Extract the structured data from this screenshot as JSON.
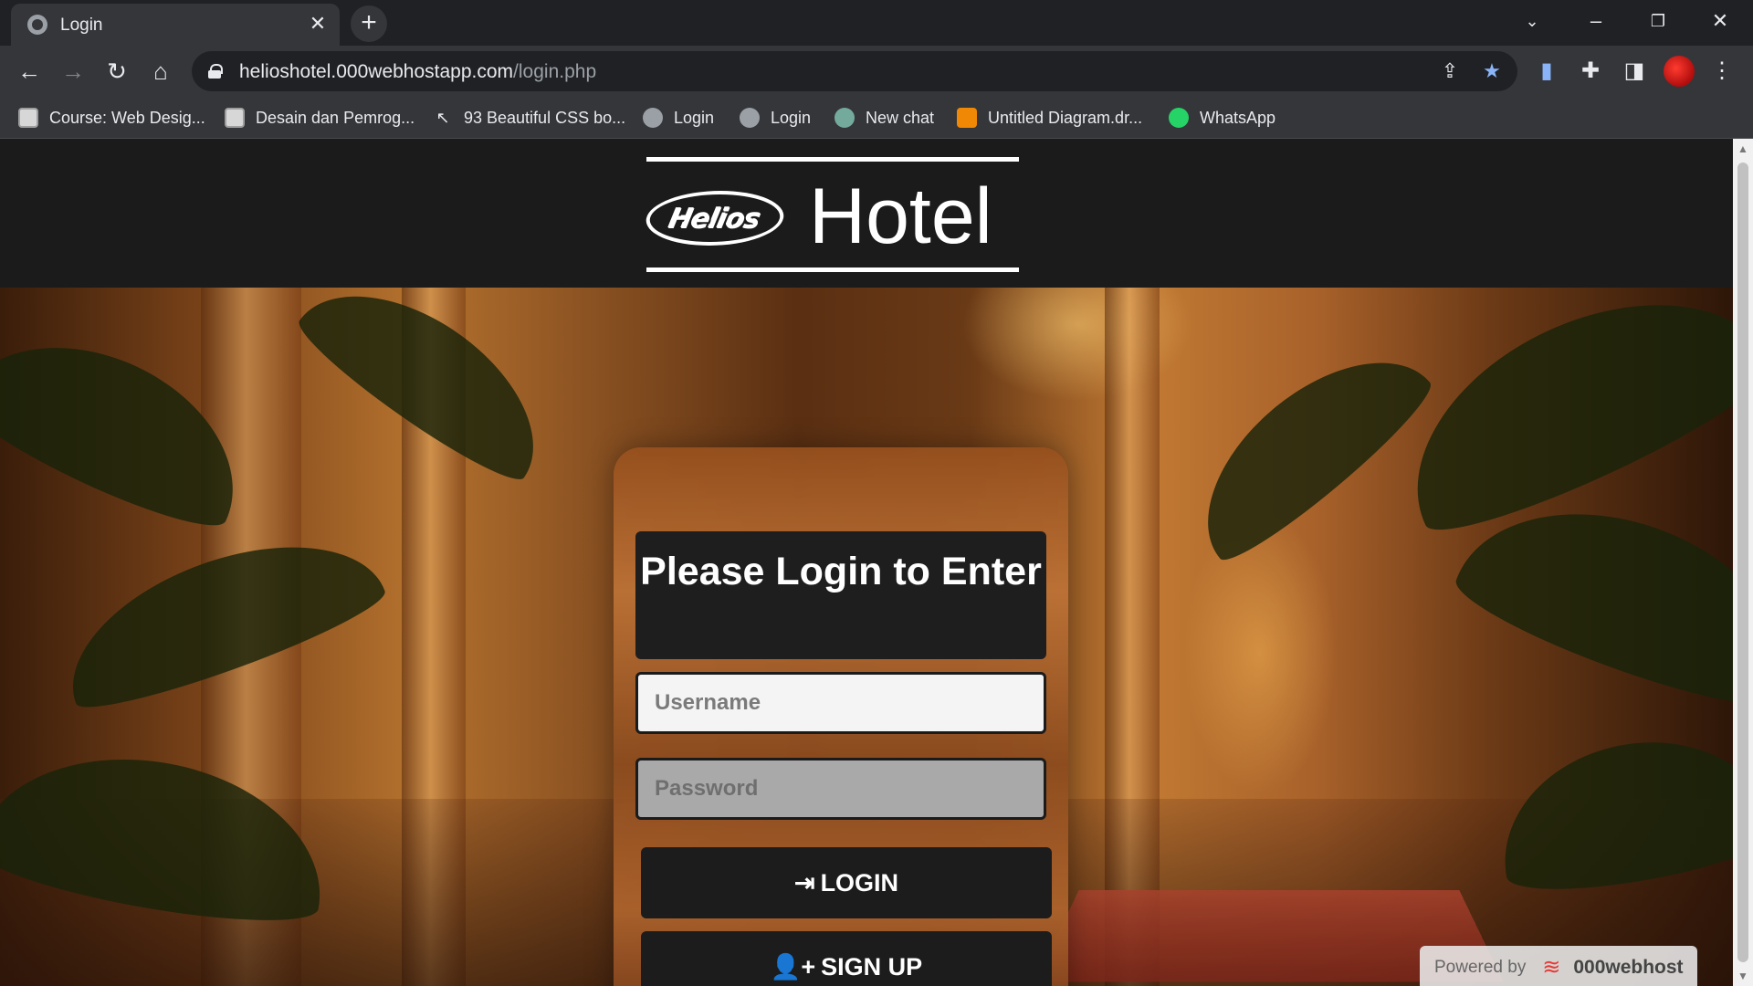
{
  "browser": {
    "tab_title": "Login",
    "url_host": "helioshotel.000webhostapp.com",
    "url_path": "/login.php",
    "icons": {
      "back": "arrow-left-icon",
      "forward": "arrow-right-icon",
      "reload": "reload-icon",
      "home": "home-icon",
      "share": "share-icon",
      "bookmark": "star-icon",
      "extensions": "puzzle-icon",
      "sidepanel": "side-panel-icon",
      "menu": "kebab-menu-icon"
    }
  },
  "bookmarks": [
    {
      "label": "Course: Web Desig...",
      "icon": "doc"
    },
    {
      "label": "Desain dan Pemrog...",
      "icon": "doc"
    },
    {
      "label": "93 Beautiful CSS bo...",
      "icon": "cursor"
    },
    {
      "label": "Login",
      "icon": "globe"
    },
    {
      "label": "Login",
      "icon": "globe"
    },
    {
      "label": "New chat",
      "icon": "gpt"
    },
    {
      "label": "Untitled Diagram.dr...",
      "icon": "drawio"
    },
    {
      "label": "WhatsApp",
      "icon": "wa"
    }
  ],
  "site": {
    "logo_mark": "Helios",
    "logo_word": "Hotel"
  },
  "login": {
    "title": "Please Login to Enter",
    "username_placeholder": "Username",
    "password_placeholder": "Password",
    "login_label": "LOGIN",
    "signup_label": "SIGN UP"
  },
  "footer": {
    "powered_by": "Powered by",
    "brand": "000webhost"
  },
  "colors": {
    "header_bg": "#1b1b1b",
    "card_bg": "#b8733a",
    "button_bg": "#1c1c1c",
    "accent_star": "#8ab4f8"
  }
}
